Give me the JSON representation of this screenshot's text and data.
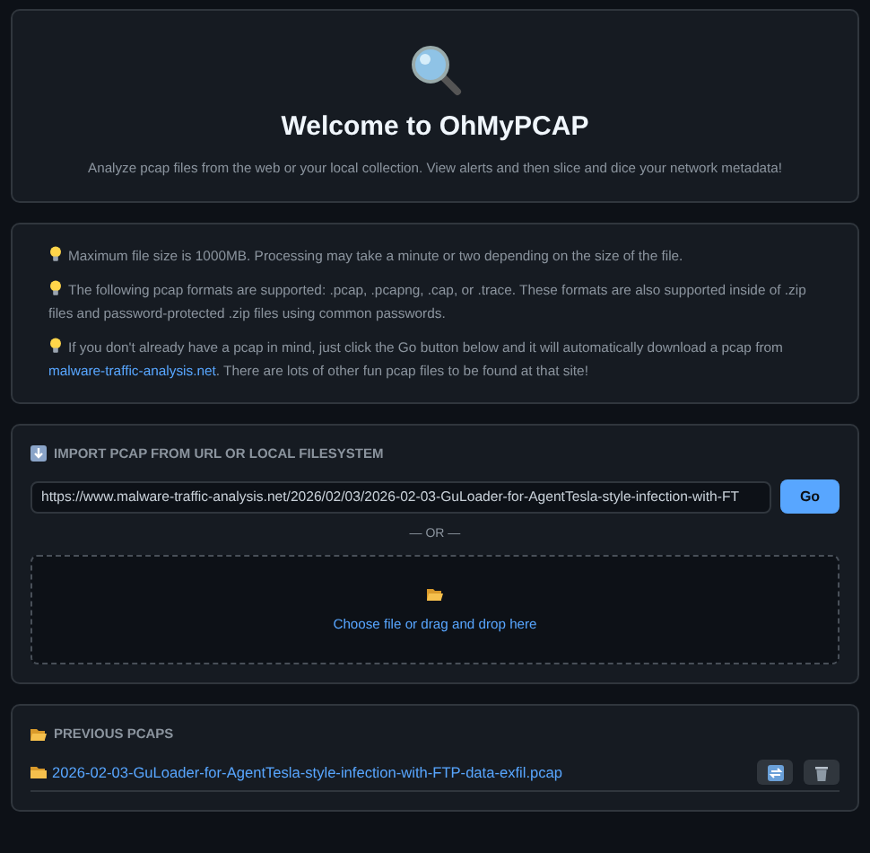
{
  "hero": {
    "title": "Welcome to OhMyPCAP",
    "subtitle": "Analyze pcap files from the web or your local collection. View alerts and then slice and dice your network metadata!"
  },
  "tips": [
    {
      "text": "Maximum file size is 1000MB. Processing may take a minute or two depending on the size of the file."
    },
    {
      "text": "The following pcap formats are supported: .pcap, .pcapng, .cap, or .trace. These formats are also supported inside of .zip files and password-protected .zip files using common passwords."
    },
    {
      "text": "If you don't already have a pcap in mind, just click the Go button below and it will automatically download a pcap from",
      "link": "malware-traffic-analysis.net",
      "after": ". There are lots of other fun pcap files to be found at that site!"
    }
  ],
  "import": {
    "heading": "IMPORT PCAP FROM URL OR LOCAL FILESYSTEM",
    "url": "https://www.malware-traffic-analysis.net/2026/02/03/2026-02-03-GuLoader-for-AgentTesla-style-infection-with-FT",
    "go": "Go",
    "or": "— OR —",
    "drop": "Choose file or drag and drop here"
  },
  "previous": {
    "heading": "PREVIOUS PCAPS",
    "files": [
      {
        "name": "2026-02-03-GuLoader-for-AgentTesla-style-infection-with-FTP-data-exfil.pcap"
      }
    ]
  }
}
